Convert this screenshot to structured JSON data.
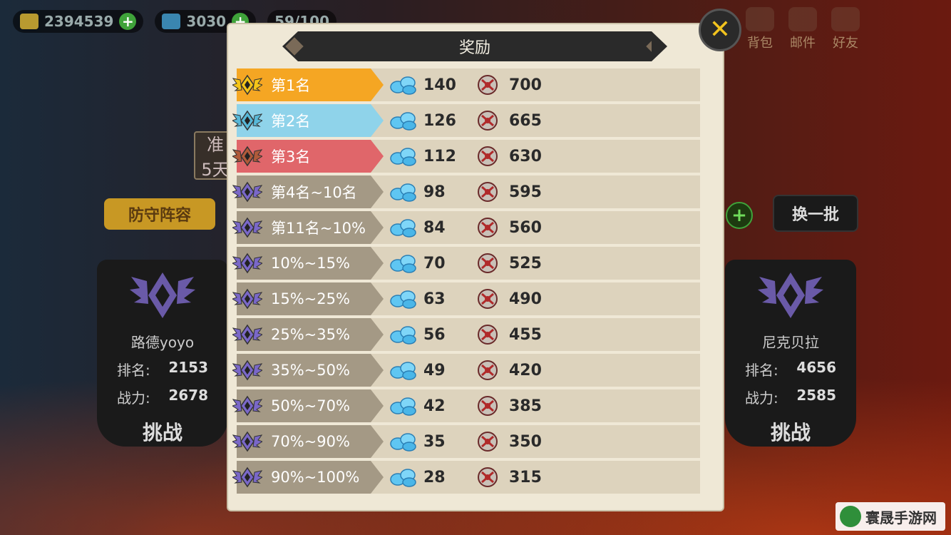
{
  "topbar": {
    "gold": "2394539",
    "gems": "3030",
    "stamina": "59/100"
  },
  "topright": {
    "bag": "背包",
    "mail": "邮件",
    "friends": "好友"
  },
  "timer": {
    "line1": "准",
    "line2": "5天"
  },
  "buttons": {
    "defend": "防守阵容",
    "swap": "换一批",
    "close": "close"
  },
  "opponents": [
    {
      "name": "路德yoyo",
      "rank_label": "排名:",
      "rank": "2153",
      "power_label": "战力:",
      "power": "2678",
      "challenge": "挑战"
    },
    {
      "name": "尼克贝拉",
      "rank_label": "排名:",
      "rank": "4656",
      "power_label": "战力:",
      "power": "2585",
      "challenge": "挑战"
    }
  ],
  "dialog": {
    "title": "奖励",
    "rows": [
      {
        "rank": "第1名",
        "gems": "140",
        "points": "700",
        "color": "#f5a623",
        "badge": "gold"
      },
      {
        "rank": "第2名",
        "gems": "126",
        "points": "665",
        "color": "#8fd3ea",
        "badge": "blue"
      },
      {
        "rank": "第3名",
        "gems": "112",
        "points": "630",
        "color": "#e0666a",
        "badge": "bronze"
      },
      {
        "rank": "第4名~10名",
        "gems": "98",
        "points": "595",
        "color": "#a49985",
        "badge": "purple"
      },
      {
        "rank": "第11名~10%",
        "gems": "84",
        "points": "560",
        "color": "#a49985",
        "badge": "purple"
      },
      {
        "rank": "10%~15%",
        "gems": "70",
        "points": "525",
        "color": "#a49985",
        "badge": "purple"
      },
      {
        "rank": "15%~25%",
        "gems": "63",
        "points": "490",
        "color": "#a49985",
        "badge": "purple"
      },
      {
        "rank": "25%~35%",
        "gems": "56",
        "points": "455",
        "color": "#a49985",
        "badge": "purple"
      },
      {
        "rank": "35%~50%",
        "gems": "49",
        "points": "420",
        "color": "#a49985",
        "badge": "purple"
      },
      {
        "rank": "50%~70%",
        "gems": "42",
        "points": "385",
        "color": "#a49985",
        "badge": "purple"
      },
      {
        "rank": "70%~90%",
        "gems": "35",
        "points": "350",
        "color": "#a49985",
        "badge": "purple"
      },
      {
        "rank": "90%~100%",
        "gems": "28",
        "points": "315",
        "color": "#a49985",
        "badge": "purple"
      }
    ]
  },
  "watermark": "寰晟手游网"
}
